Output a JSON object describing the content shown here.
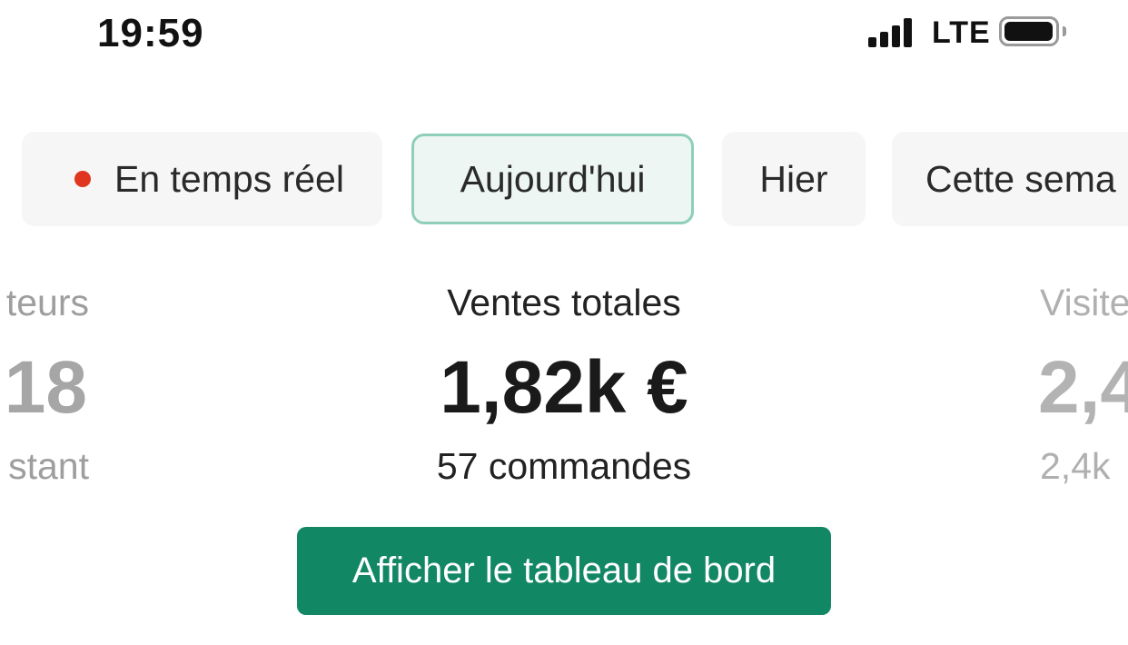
{
  "status_bar": {
    "time": "19:59",
    "network": "LTE",
    "signal_icon": "cellular-signal-icon",
    "battery_icon": "battery-icon"
  },
  "tabs": [
    {
      "label": "En temps réel",
      "icon": "live-dot-icon",
      "selected": false
    },
    {
      "label": "Aujourd'hui",
      "selected": true
    },
    {
      "label": "Hier",
      "selected": false
    },
    {
      "label": "Cette sema",
      "selected": false
    }
  ],
  "metrics": {
    "left": {
      "label": "teurs",
      "value": "18",
      "sub": "stant"
    },
    "center": {
      "label": "Ventes totales",
      "value": "1,82k €",
      "sub": "57 commandes"
    },
    "right": {
      "label": "Visite",
      "value": "2,4",
      "sub": "2,4k"
    }
  },
  "actions": {
    "dashboard_button": "Afficher le tableau de bord"
  },
  "colors": {
    "accent": "#128764",
    "live_indicator": "#e0351f",
    "selected_tab_border": "#8fcfb8"
  }
}
